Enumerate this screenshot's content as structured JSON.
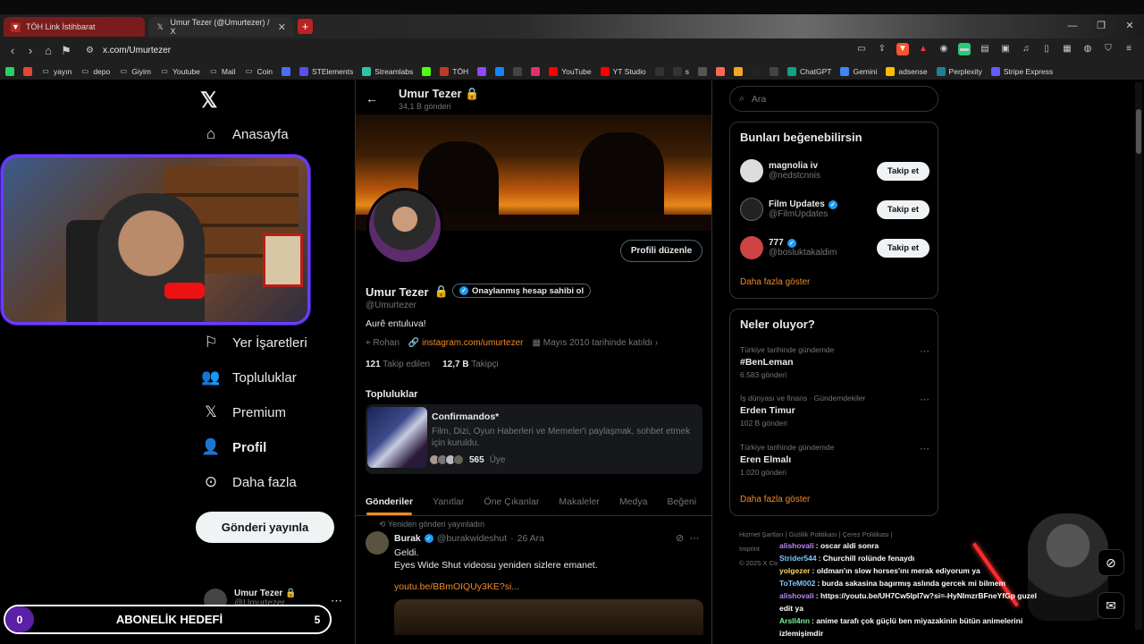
{
  "browser": {
    "tabs": [
      {
        "title": "TÖH Link İstihbarat",
        "favicon": "shield-icon",
        "color": "#b02a2a"
      },
      {
        "title": "Umur Tezer (@Umurtezer) / X",
        "favicon": "x-icon"
      }
    ],
    "url": "x.com/Umurtezer",
    "bookmarks": [
      {
        "label": "",
        "icon": "whatsapp-icon",
        "color": "#25d366"
      },
      {
        "label": "",
        "icon": "google-icon",
        "color": "#ea4335"
      },
      {
        "label": "yayın",
        "icon": "folder-icon"
      },
      {
        "label": "depo",
        "icon": "folder-icon"
      },
      {
        "label": "Giyim",
        "icon": "folder-icon"
      },
      {
        "label": "Youtube",
        "icon": "folder-icon"
      },
      {
        "label": "Mail",
        "icon": "folder-icon"
      },
      {
        "label": "Coin",
        "icon": "folder-icon"
      },
      {
        "label": "",
        "icon": "r-icon",
        "color": "#4a6cf7"
      },
      {
        "label": "STElements",
        "icon": "st-icon",
        "color": "#5a4ef0"
      },
      {
        "label": "Streamlabs",
        "icon": "streamlabs-icon",
        "color": "#31c3a2"
      },
      {
        "label": "",
        "icon": "kick-icon",
        "color": "#53fc18"
      },
      {
        "label": "TÖH",
        "icon": "shield-icon",
        "color": "#c0392b"
      },
      {
        "label": "",
        "icon": "twitch-icon",
        "color": "#9146ff"
      },
      {
        "label": "",
        "icon": "bluesky-icon",
        "color": "#1185fe"
      },
      {
        "label": "",
        "icon": "x-icon",
        "color": "#444"
      },
      {
        "label": "",
        "icon": "instagram-icon",
        "color": "#e1306c"
      },
      {
        "label": "YouTube",
        "icon": "youtube-icon",
        "color": "#ff0000"
      },
      {
        "label": "YT Studio",
        "icon": "youtube-icon",
        "color": "#ff0000"
      },
      {
        "label": "",
        "icon": "tiktok-icon",
        "color": "#333"
      },
      {
        "label": "s",
        "icon": "tiktok-icon",
        "color": "#333"
      },
      {
        "label": "",
        "icon": "circle-icon",
        "color": "#555"
      },
      {
        "label": "",
        "icon": "patreon-icon",
        "color": "#f96854"
      },
      {
        "label": "",
        "icon": "app-icon",
        "color": "#f5a623"
      },
      {
        "label": "",
        "icon": "app-icon",
        "color": "#222"
      },
      {
        "label": "",
        "icon": "app-icon",
        "color": "#444"
      },
      {
        "label": "ChatGPT",
        "icon": "chatgpt-icon",
        "color": "#10a37f"
      },
      {
        "label": "Gemini",
        "icon": "gemini-icon",
        "color": "#4285f4"
      },
      {
        "label": "adsense",
        "icon": "adsense-icon",
        "color": "#fbbc04"
      },
      {
        "label": "Perplexity",
        "icon": "perplexity-icon",
        "color": "#20808d"
      },
      {
        "label": "Stripe Express",
        "icon": "stripe-icon",
        "color": "#635bff"
      }
    ]
  },
  "nav": {
    "items": [
      {
        "label": "Anasayfa",
        "icon": "home-icon"
      },
      {
        "label": "Yer İşaretleri",
        "icon": "bookmark-icon"
      },
      {
        "label": "Topluluklar",
        "icon": "communities-icon"
      },
      {
        "label": "Premium",
        "icon": "x-icon"
      },
      {
        "label": "Profil",
        "icon": "profile-icon"
      },
      {
        "label": "Daha fazla",
        "icon": "more-icon"
      }
    ],
    "post_button": "Gönderi yayınla",
    "mini_profile": {
      "name": "Umur Tezer",
      "handle": "@Umurtezer"
    }
  },
  "goal": {
    "title": "ABONELİK HEDEFİ",
    "current": "0",
    "target": "5"
  },
  "profile": {
    "header_name": "Umur Tezer",
    "post_count": "34,1 B gönderi",
    "edit_button": "Profili düzenle",
    "name": "Umur Tezer",
    "verify_button": "Onaylanmış hesap sahibi ol",
    "handle": "@Umurtezer",
    "bio": "Aurê entuluva!",
    "location": "Rohan",
    "link": "instagram.com/umurtezer",
    "joined": "Mayıs 2010 tarihinde katıldı",
    "following_count": "121",
    "following_label": "Takip edilen",
    "followers_count": "12,7 B",
    "followers_label": "Takipçi",
    "communities_title": "Topluluklar",
    "community": {
      "name": "Confirmandos*",
      "desc": "Film, Dizi, Oyun Haberleri ve Memeler'i paylaşmak, sohbet etmek için kuruldu.",
      "members": "565",
      "members_label": "Üye"
    },
    "tabs": [
      "Gönderiler",
      "Yanıtlar",
      "Öne Çıkanlar",
      "Makaleler",
      "Medya",
      "Beğeni"
    ],
    "tweet": {
      "repost_note": "Yeniden gönderi yayınladın",
      "author": "Burak",
      "handle": "@burakwideshut",
      "date": "26 Ara",
      "line1": "Geldi.",
      "line2": "Eyes Wide Shut videosu yeniden sizlere emanet.",
      "link": "youtu.be/BBmOIQUy3KE?si..."
    }
  },
  "right": {
    "search_placeholder": "Ara",
    "who_title": "Bunları beğenebilirsin",
    "who": [
      {
        "name": "magnolia iv",
        "handle": "@nedstcnnis",
        "verified": false,
        "button": "Takip et"
      },
      {
        "name": "Film Updates",
        "handle": "@FilmUpdates",
        "verified": true,
        "button": "Takip et"
      },
      {
        "name": "777",
        "handle": "@bosluktakaldim",
        "verified": true,
        "button": "Takip et"
      }
    ],
    "show_more": "Daha fazla göster",
    "trends_title": "Neler oluyor?",
    "trends": [
      {
        "context": "Türkiye tarihinde gündemde",
        "title": "#BenLeman",
        "posts": "6.583 gönderi"
      },
      {
        "context": "İş dünyası ve finans · Gündemdekiler",
        "title": "Erden Timur",
        "posts": "102 B gönderi"
      },
      {
        "context": "Türkiye tarihinde gündemde",
        "title": "Eren Elmalı",
        "posts": "1.020 gönderi"
      }
    ],
    "trends_more": "Daha fazla göster",
    "footer": [
      "Hizmet Şartları",
      "Gizlilik Politikası",
      "Çerez Politikası",
      "Imprint",
      "© 2025 X Co"
    ]
  },
  "chat": [
    {
      "user": "alishovali",
      "color": "#c084fc",
      "text": "oscar aldi sonra"
    },
    {
      "user": "Strider544",
      "color": "#7ec8ff",
      "text": "Churchill rolünde fenaydı"
    },
    {
      "user": "yolgezer",
      "color": "#ffd166",
      "text": "oldman'ın slow horses'ını merak ediyorum ya"
    },
    {
      "user": "ToTeM002",
      "color": "#7ec8ff",
      "text": "burda sakasina bagırmış aslında gercek mi bilmem"
    },
    {
      "user": "alishovali",
      "color": "#c084fc",
      "text": "https://youtu.be/UH7Cw5lpI7w?si=-HyNImzrBFneYfGp guzel edit ya"
    },
    {
      "user": "Arsll4nn",
      "color": "#7bed9f",
      "text": "anime tarafı çok güçlü ben miyazakinin bütün animelerini izlemişimdir"
    }
  ]
}
